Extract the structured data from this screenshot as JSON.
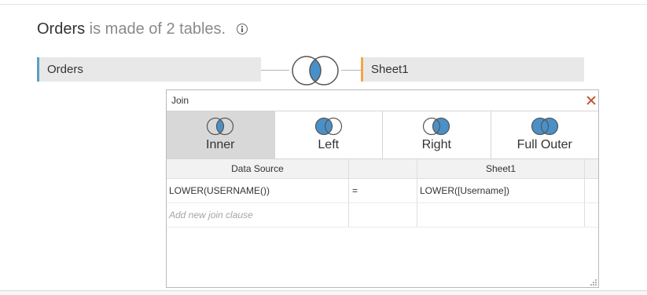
{
  "header": {
    "table_name": "Orders",
    "description": " is made of 2 tables.",
    "info_icon": "info-icon"
  },
  "tables": {
    "left": {
      "label": "Orders",
      "accent": "#5b9ec9"
    },
    "right": {
      "label": "Sheet1",
      "accent": "#f2a64a"
    },
    "join_icon": "inner-join-venn-icon"
  },
  "join_dialog": {
    "title": "Join",
    "close_icon": "close-icon",
    "join_types": [
      {
        "label": "Inner",
        "icon": "inner-join-icon",
        "selected": true
      },
      {
        "label": "Left",
        "icon": "left-join-icon",
        "selected": false
      },
      {
        "label": "Right",
        "icon": "right-join-icon",
        "selected": false
      },
      {
        "label": "Full Outer",
        "icon": "full-outer-join-icon",
        "selected": false
      }
    ],
    "columns": {
      "left": "Data Source",
      "right": "Sheet1"
    },
    "clauses": [
      {
        "left": "LOWER(USERNAME())",
        "operator": "=",
        "right": "LOWER([Username])"
      }
    ],
    "add_clause_placeholder": "Add new join clause"
  },
  "colors": {
    "venn_fill": "#4a90c8",
    "venn_stroke": "#3a6f96",
    "selected_tab_bg": "#d8d8d8",
    "close_x": "#c2562f"
  }
}
